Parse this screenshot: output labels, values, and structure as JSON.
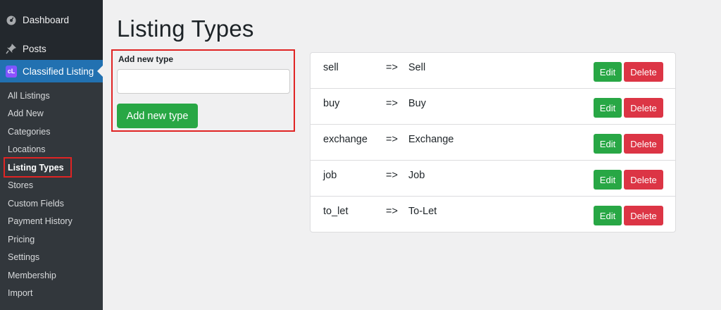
{
  "sidebar": {
    "top_items": [
      {
        "label": "Dashboard",
        "icon": "dashboard-icon"
      },
      {
        "label": "Posts",
        "icon": "pin-icon"
      },
      {
        "label": "Classified Listing",
        "icon": "classified-listing-logo",
        "logo_text": "cL"
      }
    ],
    "sub_items": [
      {
        "label": "All Listings"
      },
      {
        "label": "Add New"
      },
      {
        "label": "Categories"
      },
      {
        "label": "Locations"
      },
      {
        "label": "Listing Types",
        "active": true
      },
      {
        "label": "Stores"
      },
      {
        "label": "Custom Fields"
      },
      {
        "label": "Payment History"
      },
      {
        "label": "Pricing"
      },
      {
        "label": "Settings"
      },
      {
        "label": "Membership"
      },
      {
        "label": "Import"
      }
    ]
  },
  "page": {
    "title": "Listing Types"
  },
  "add_form": {
    "label": "Add new type",
    "input_value": "",
    "button_label": "Add new type"
  },
  "types": [
    {
      "key": "sell",
      "arrow": "=>",
      "value": "Sell",
      "edit_label": "Edit",
      "delete_label": "Delete"
    },
    {
      "key": "buy",
      "arrow": "=>",
      "value": "Buy",
      "edit_label": "Edit",
      "delete_label": "Delete"
    },
    {
      "key": "exchange",
      "arrow": "=>",
      "value": "Exchange",
      "edit_label": "Edit",
      "delete_label": "Delete"
    },
    {
      "key": "job",
      "arrow": "=>",
      "value": "Job",
      "edit_label": "Edit",
      "delete_label": "Delete"
    },
    {
      "key": "to_let",
      "arrow": "=>",
      "value": "To-Let",
      "edit_label": "Edit",
      "delete_label": "Delete"
    }
  ],
  "colors": {
    "sidebar_bg": "#23282d",
    "active_menu": "#2271b1",
    "success": "#28a745",
    "danger": "#dc3545",
    "highlight": "#e02424"
  }
}
